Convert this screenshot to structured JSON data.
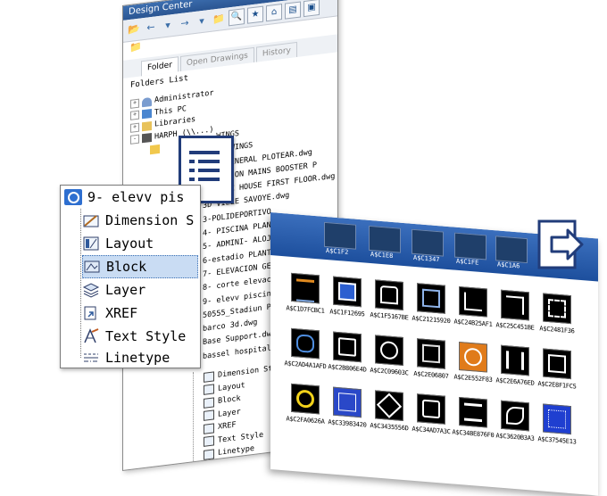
{
  "window": {
    "title": "Design Center",
    "tabs": [
      "Folder",
      "Open Drawings",
      "History"
    ],
    "folders_list_label": "Folders List"
  },
  "tree": [
    {
      "label": "Administrator",
      "toggle": "+"
    },
    {
      "label": "This PC",
      "toggle": "+"
    },
    {
      "label": "Libraries",
      "toggle": "+"
    },
    {
      "label": "HARPH (\\\\...)",
      "toggle": "-"
    }
  ],
  "files": [
    "...WINGS",
    "...DRAWINGS",
    "...A GENERAL PLOTEAR.dwg",
    "...GATION MAINS BOOSTER P",
    "3D SINC HOUSE FIRST FLOOR.dwg",
    "3D VILLE SAVOYE.dwg",
    "3-POLIDEPORTIVO",
    "4- PISCINA PLANT",
    "5- ADMINI- ALOJA",
    "6-estadio PLANTA G",
    "7- ELEVACION GENE",
    "8-  corte elevacio",
    "9- elevv piscina.dwg",
    "50555_Stadiun Plan.dwg",
    "barco 3d.dwg",
    "Base Support.dwg",
    "bassel hospital.dwg"
  ],
  "subitems": [
    "Dimension Style",
    "Layout",
    "Block",
    "Layer",
    "XREF",
    "Text Style",
    "Linetype"
  ],
  "popup": {
    "title": "9- elevv pis",
    "items": [
      {
        "label": "Dimension S",
        "icon": "dimension-style-icon"
      },
      {
        "label": "Layout",
        "icon": "layout-icon"
      },
      {
        "label": "Block",
        "icon": "block-icon",
        "selected": true
      },
      {
        "label": "Layer",
        "icon": "layer-icon"
      },
      {
        "label": "XREF",
        "icon": "xref-icon"
      },
      {
        "label": "Text Style",
        "icon": "text-style-icon"
      },
      {
        "label": "Linetype",
        "icon": "linetype-icon"
      }
    ]
  },
  "thumbs_top": [
    "",
    "A$C1F2",
    "A$C1E8",
    "A$C1347",
    "A$C1FE",
    "A$C1A6",
    "A$C1A"
  ],
  "thumbs": [
    [
      "A$C1D7FCBC1",
      "A$C1F12695",
      "A$C1F5167BE",
      "A$C21215920",
      "A$C24B25AF1",
      "A$C25C451BE",
      "A$C2481F36"
    ],
    [
      "A$C2AD4A1AFD",
      "A$C2B806E4D",
      "A$C2C09603C",
      "A$C2E06807",
      "A$C2E552F83",
      "A$C2E6A76ED",
      "A$C2E8F1FC5"
    ],
    [
      "A$C2FA0626A",
      "A$C33983420",
      "A$C3435556D",
      "A$C34AD7A3C",
      "A$C34BE876F0",
      "A$C3620B3A3",
      "A$C37545E13"
    ]
  ],
  "colors": {
    "accent": "#213c7a",
    "band": "#2b5ea8",
    "selection": "#c9dcf3"
  }
}
